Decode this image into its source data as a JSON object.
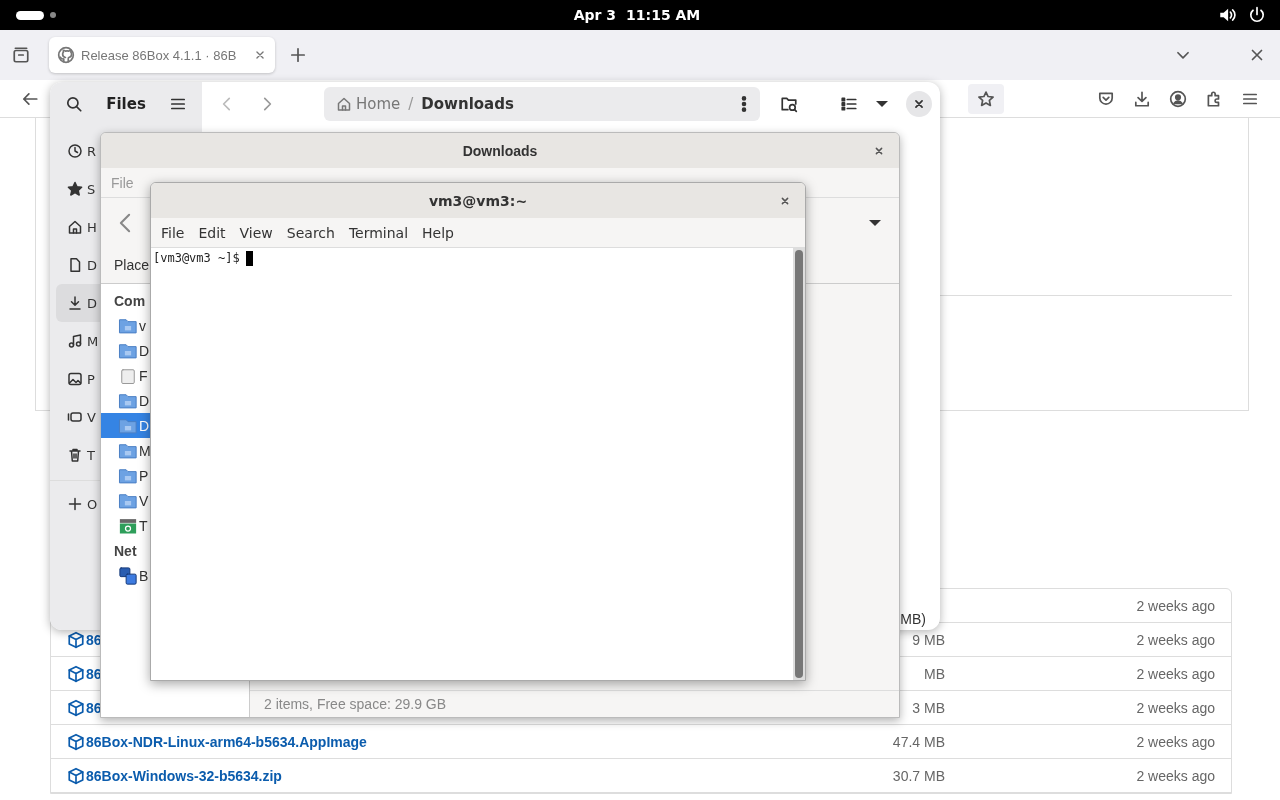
{
  "top_bar": {
    "date": "Apr 3",
    "time": "11:15 AM"
  },
  "browser": {
    "tabs": [
      {
        "title": "Release 86Box 4.1.1 · 86B",
        "selected": true
      }
    ],
    "assets": [
      {
        "time": "2 weeks ago"
      },
      {
        "name": "86",
        "size": "9 MB",
        "time": "2 weeks ago"
      },
      {
        "name": "86",
        "size": "MB",
        "time": "2 weeks ago"
      },
      {
        "name": "86",
        "size": "3 MB",
        "time": "2 weeks ago"
      },
      {
        "name": "86Box-NDR-Linux-arm64-b5634.AppImage",
        "size": "47.4 MB",
        "time": "2 weeks ago"
      },
      {
        "name": "86Box-Windows-32-b5634.zip",
        "size": "30.7 MB",
        "time": "2 weeks ago"
      }
    ]
  },
  "files_window": {
    "title": "Files",
    "path": [
      "Home",
      "Downloads"
    ],
    "path_separator": "/",
    "list_text": "MB)",
    "sidebar": [
      {
        "label": "R",
        "selected": false
      },
      {
        "label": "S",
        "selected": false
      },
      {
        "label": "H",
        "selected": false
      },
      {
        "label": "D",
        "selected": false
      },
      {
        "label": "D",
        "selected": true
      },
      {
        "label": "M",
        "selected": false
      },
      {
        "label": "P",
        "selected": false
      },
      {
        "label": "V",
        "selected": false
      },
      {
        "label": "T",
        "selected": false
      },
      {
        "label": "O",
        "selected": false
      }
    ]
  },
  "downloads_window": {
    "title": "Downloads",
    "menu": [
      "File"
    ],
    "places_label": "Place",
    "status": "2 items, Free space: 29.9 GB",
    "sections": [
      {
        "heading": "Com",
        "items": [
          {
            "label": "v",
            "kind": "folder",
            "selected": false
          },
          {
            "label": "D",
            "kind": "folder",
            "selected": false
          },
          {
            "label": "F",
            "kind": "drive",
            "selected": false
          },
          {
            "label": "D",
            "kind": "folder",
            "selected": false
          },
          {
            "label": "D",
            "kind": "folder",
            "selected": true
          },
          {
            "label": "M",
            "kind": "folder",
            "selected": false
          },
          {
            "label": "P",
            "kind": "folder",
            "selected": false
          },
          {
            "label": "V",
            "kind": "folder",
            "selected": false
          },
          {
            "label": "T",
            "kind": "trash",
            "selected": false
          }
        ]
      },
      {
        "heading": "Net",
        "items": [
          {
            "label": "B",
            "kind": "network",
            "selected": false
          }
        ]
      }
    ]
  },
  "terminal": {
    "title": "vm3@vm3:~",
    "menu": [
      "File",
      "Edit",
      "View",
      "Search",
      "Terminal",
      "Help"
    ],
    "prompt": "[vm3@vm3 ~]$"
  }
}
